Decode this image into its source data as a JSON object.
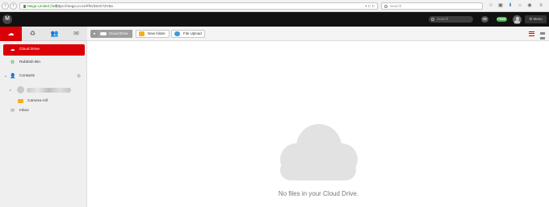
{
  "browser": {
    "url_site": "Mega Limited (NZ)",
    "url": "https://mega.co.nz/#fm/3SzK7ZV5a",
    "search_placeholder": "Search"
  },
  "header": {
    "search_placeholder": "Search",
    "account_badge": "FREE",
    "menu_label": "Menu",
    "logo_letter": "M"
  },
  "left_tabs": [
    {
      "name": "cloud-drive",
      "icon": "cloud-icon",
      "active": true
    },
    {
      "name": "rubbish-bin",
      "icon": "recycle-icon",
      "active": false
    },
    {
      "name": "contacts",
      "icon": "contacts-icon",
      "active": false
    },
    {
      "name": "inbox",
      "icon": "inbox-icon",
      "active": false
    }
  ],
  "sidebar": {
    "items": [
      {
        "label": "Cloud Drive",
        "icon": "cloud-icon",
        "active": true
      },
      {
        "label": "Rubbish Bin",
        "icon": "recycle-icon",
        "active": false
      },
      {
        "label": "Contacts",
        "icon": "contacts-icon",
        "active": false
      },
      {
        "label": "",
        "icon": "avatar-icon",
        "active": false
      },
      {
        "label": "Camera roll",
        "icon": "folder-icon",
        "active": false
      },
      {
        "label": "Inbox",
        "icon": "inbox-icon",
        "active": false
      }
    ]
  },
  "toolbar": {
    "breadcrumb": "Cloud Drive",
    "new_folder": "New folder",
    "file_upload": "File Upload"
  },
  "main": {
    "empty_message": "No files in your Cloud Drive."
  },
  "colors": {
    "accent": "#d90007",
    "free_badge": "#3cb043",
    "topbar": "#111111"
  }
}
